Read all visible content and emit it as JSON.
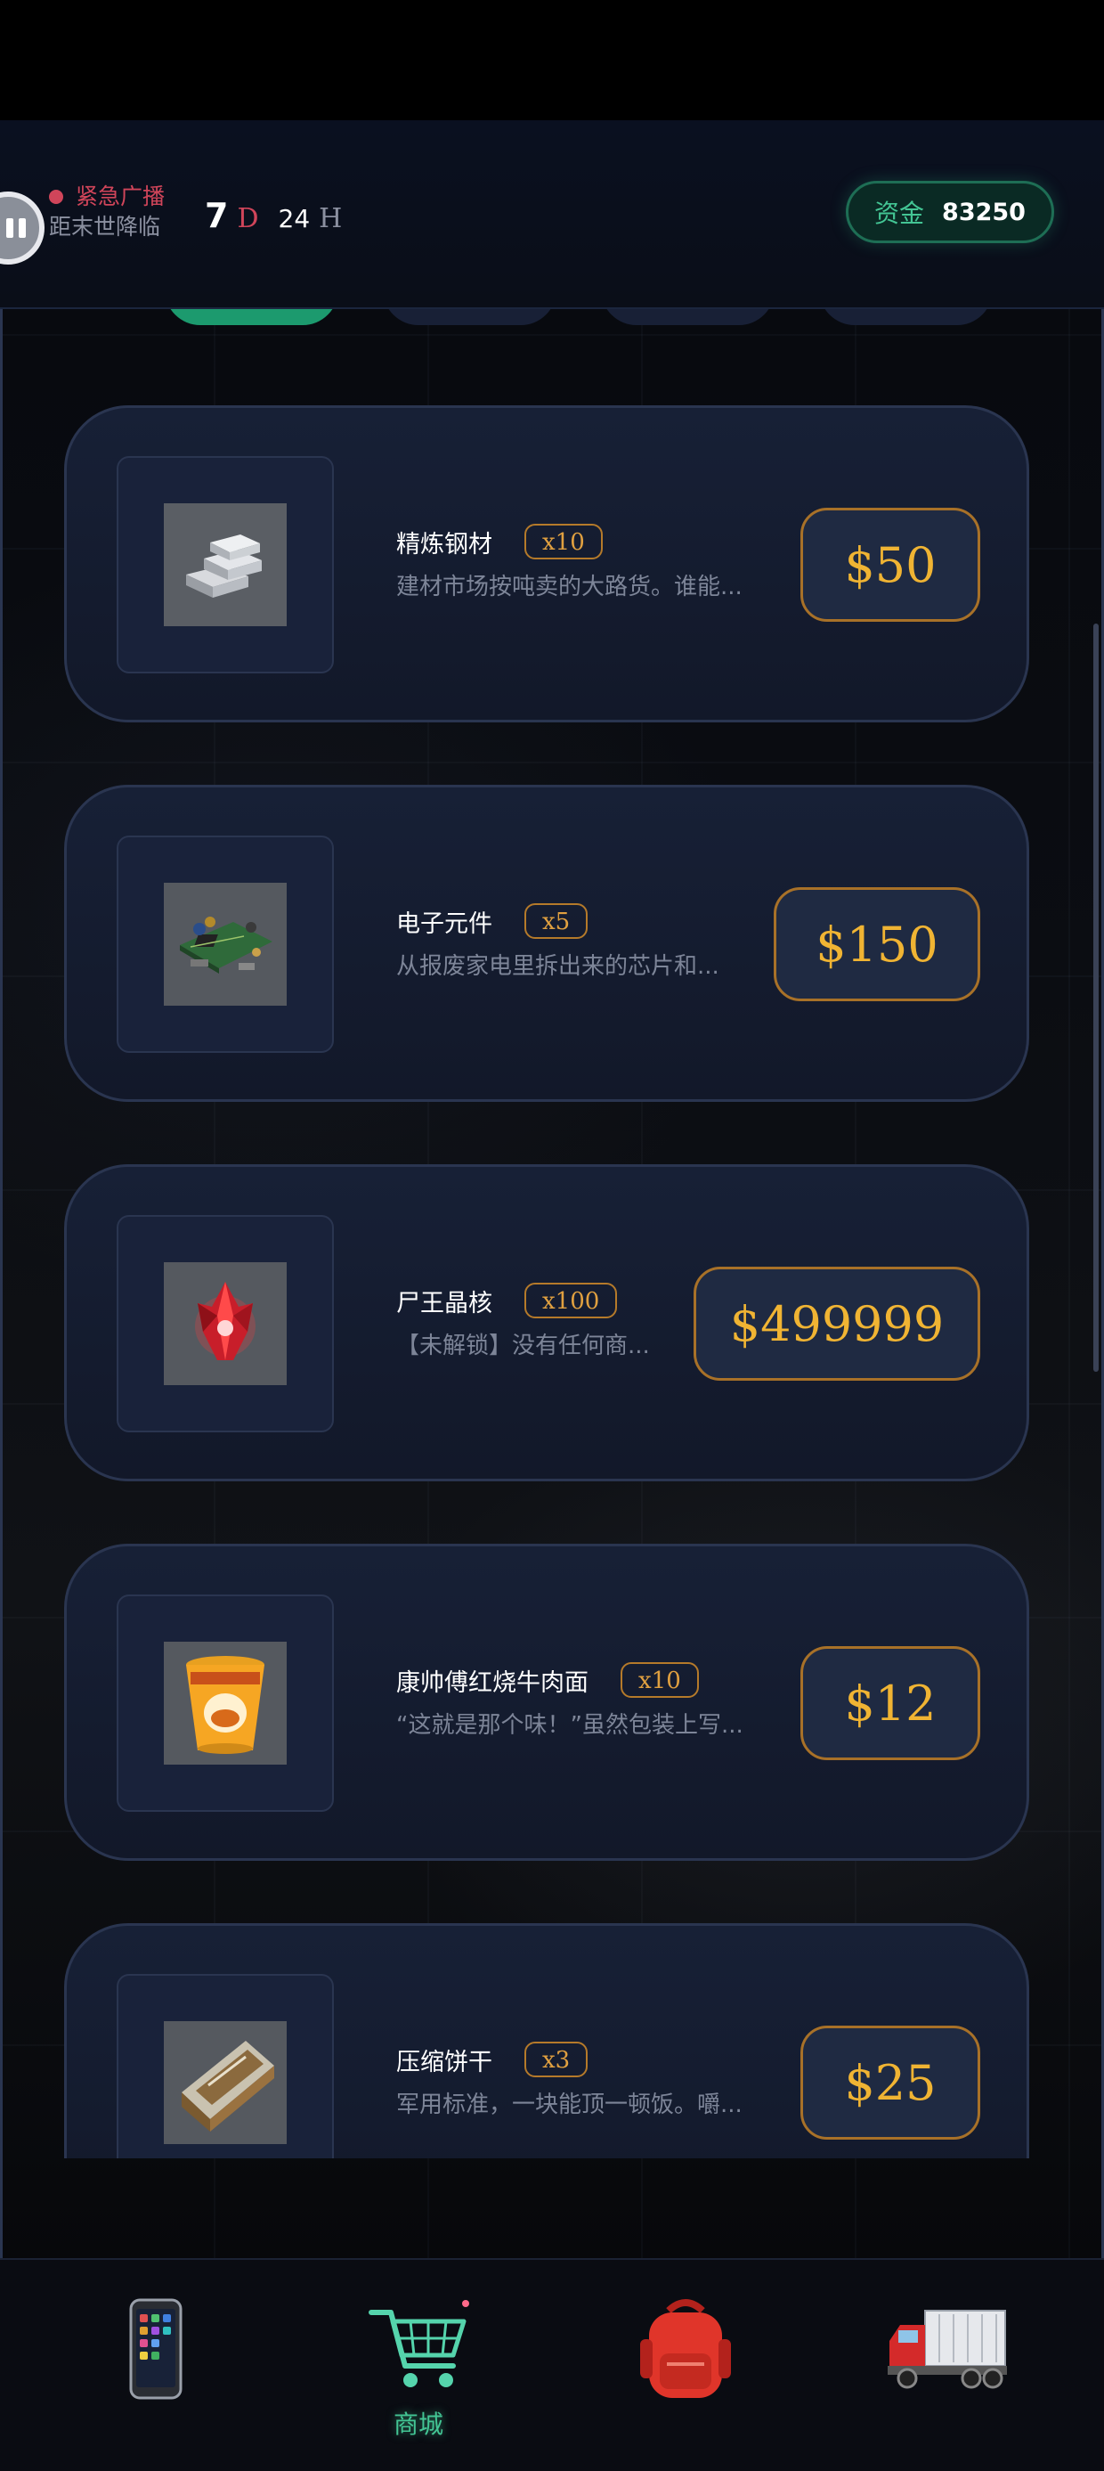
{
  "header": {
    "broadcast_title": "紧急广播",
    "broadcast_subtitle": "距末世降临",
    "countdown_days": "7",
    "countdown_days_unit": "D",
    "countdown_hours": "24",
    "countdown_hours_unit": "H",
    "funds_label": "资金",
    "funds_value": "83250"
  },
  "products": [
    {
      "name": "精炼钢材",
      "qty": "x10",
      "description": "建材市场按吨卖的大路货。谁能...",
      "price": "$50",
      "icon": "steel-ingot-icon"
    },
    {
      "name": "电子元件",
      "qty": "x5",
      "description": "从报废家电里拆出来的芯片和...",
      "price": "$150",
      "icon": "circuit-board-icon"
    },
    {
      "name": "尸王晶核",
      "qty": "x100",
      "description": "【未解锁】没有任何商...",
      "price": "$499999",
      "icon": "red-crystal-icon"
    },
    {
      "name": "康帅傅红烧牛肉面",
      "qty": "x10",
      "description": "“这就是那个味！”虽然包装上写...",
      "price": "$12",
      "icon": "instant-noodle-icon"
    },
    {
      "name": "压缩饼干",
      "qty": "x3",
      "description": "军用标准，一块能顶一顿饭。嚼...",
      "price": "$25",
      "icon": "compressed-biscuit-icon"
    }
  ],
  "nav": {
    "items": [
      {
        "icon": "phone-icon",
        "label": ""
      },
      {
        "icon": "shopping-cart-icon",
        "label": "商城"
      },
      {
        "icon": "backpack-icon",
        "label": ""
      },
      {
        "icon": "truck-icon",
        "label": ""
      }
    ]
  },
  "colors": {
    "accent_green": "#43c594",
    "price_gold": "#f0b433",
    "alert_red": "#d0455a",
    "card_bg": "#172036"
  }
}
